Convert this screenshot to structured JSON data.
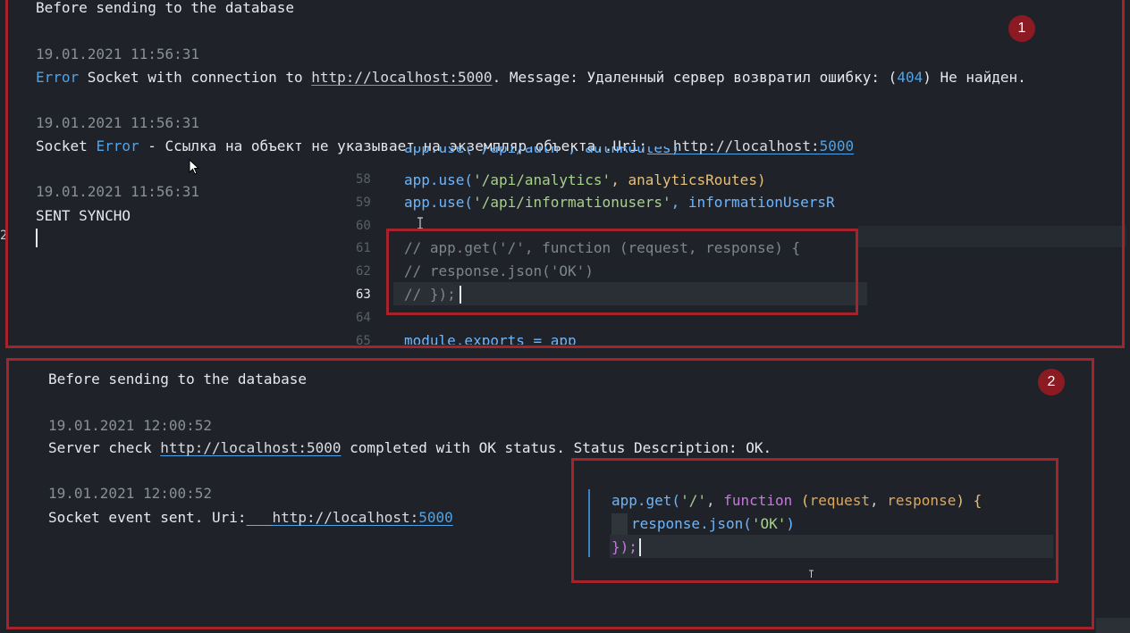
{
  "panel1": {
    "badge": "1",
    "line1": "Before sending to the database",
    "ts1": "19.01.2021 11:56:31",
    "err1_word": "Error",
    "err1_pre": " Socket with connection to ",
    "err1_link": "http://localhost:5000",
    "err1_post_a": ". Message: Удаленный сервер возвратил ошибку: (",
    "err1_code": "404",
    "err1_post_b": ") Не найден.",
    "ts2": "19.01.2021 11:56:31",
    "err2_pre": "Socket ",
    "err2_word": "Error",
    "err2_post": " - Ссылка на объект не указывает на экземпляр объекта..Uri:",
    "err2_underscores": "___",
    "err2_link_a": "http://localhost:",
    "err2_link_b": "5000",
    "ts3": "19.01.2021 11:56:31",
    "sent": "SENT SYNCHO",
    "code": {
      "lines": [
        {
          "num": "58",
          "a": "app.use(",
          "s": "'/api/analytics'",
          "b": ", analyticsRoutes)"
        },
        {
          "num": "59",
          "a": "app.use(",
          "s": "'/api/informationusers'",
          "b": ", informationUsersR"
        },
        {
          "num": "60",
          "text": ""
        },
        {
          "num": "61",
          "text": "// app.get('/', function (request, response) {"
        },
        {
          "num": "62",
          "text": "//   response.json('OK')"
        },
        {
          "num": "63",
          "text": "// });"
        },
        {
          "num": "64",
          "text": ""
        },
        {
          "num": "65",
          "text": "module.exports = app"
        }
      ],
      "partial_top": "app.use('/api/auth', authRoutes)"
    }
  },
  "panel2": {
    "badge": "2",
    "line1": "Before sending to the database",
    "ts1": "19.01.2021 12:00:52",
    "ok_pre": "Server check ",
    "ok_link": "http://localhost:5000",
    "ok_post": " completed with OK status. Status Description: OK.",
    "ts2": "19.01.2021 12:00:52",
    "ev_pre": "Socket event sent. Uri:",
    "ev_underscores": "___",
    "ev_link_a": "http://localhost:",
    "ev_link_b": "5000",
    "code": {
      "l1_fn": "app.get(",
      "l1_str": "'/'",
      "l1_comma": ", ",
      "l1_kw": "function",
      "l1_params_open": " (",
      "l1_p1": "request",
      "l1_sep": ", ",
      "l1_p2": "response",
      "l1_params_close": ") {",
      "l2_a": "response.json(",
      "l2_str": "'OK'",
      "l2_b": ")",
      "l3": "});"
    }
  }
}
